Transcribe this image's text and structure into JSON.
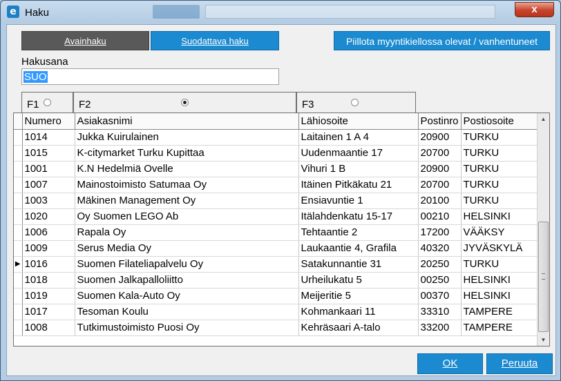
{
  "window": {
    "title": "Haku",
    "app_icon_glyph": "e",
    "close_glyph": "x"
  },
  "toolbar": {
    "key_search_label": "Avainhaku",
    "filter_search_label": "Suodattava haku",
    "hide_label": "Piillota myyntikiellossa olevat / vanhentuneet"
  },
  "search": {
    "label": "Hakusana",
    "value": "SUO"
  },
  "field_options": [
    {
      "label": "F1",
      "selected": false
    },
    {
      "label": "F2",
      "selected": true
    },
    {
      "label": "F3",
      "selected": false
    }
  ],
  "grid": {
    "columns": [
      "Numero",
      "Asiakasnimi",
      "Lähiosoite",
      "Postinro",
      "Postiosoite"
    ],
    "current_row_marker": "▶",
    "rows": [
      {
        "current": false,
        "cells": [
          "1014",
          "Jukka Kuirulainen",
          "Laitainen 1 A 4",
          "20900",
          "TURKU"
        ]
      },
      {
        "current": false,
        "cells": [
          "1015",
          "K-citymarket Turku Kupittaa",
          "Uudenmaantie 17",
          "20700",
          "TURKU"
        ]
      },
      {
        "current": false,
        "cells": [
          "1001",
          "K.N Hedelmiä Ovelle",
          "Vihuri 1 B",
          "20900",
          "TURKU"
        ]
      },
      {
        "current": false,
        "cells": [
          "1007",
          "Mainostoimisto Satumaa Oy",
          "Itäinen Pitkäkatu 21",
          "20700",
          "TURKU"
        ]
      },
      {
        "current": false,
        "cells": [
          "1003",
          "Mäkinen Management Oy",
          "Ensiavuntie 1",
          "20100",
          "TURKU"
        ]
      },
      {
        "current": false,
        "cells": [
          "1020",
          "Oy Suomen LEGO Ab",
          "Itälahdenkatu 15-17",
          "00210",
          "HELSINKI"
        ]
      },
      {
        "current": false,
        "cells": [
          "1006",
          "Rapala Oy",
          "Tehtaantie 2",
          "17200",
          "VÄÄKSY"
        ]
      },
      {
        "current": false,
        "cells": [
          "1009",
          "Serus Media Oy",
          "Laukaantie 4, Grafila",
          "40320",
          "JYVÄSKYLÄ"
        ]
      },
      {
        "current": true,
        "cells": [
          "1016",
          "Suomen Filateliapalvelu Oy",
          "Satakunnantie 31",
          "20250",
          "TURKU"
        ]
      },
      {
        "current": false,
        "cells": [
          "1018",
          "Suomen Jalkapalloliitto",
          "Urheilukatu 5",
          "00250",
          "HELSINKI"
        ]
      },
      {
        "current": false,
        "cells": [
          "1019",
          "Suomen Kala-Auto Oy",
          "Meijeritie 5",
          "00370",
          "HELSINKI"
        ]
      },
      {
        "current": false,
        "cells": [
          "1017",
          "Tesoman Koulu",
          "Kohmankaari 11",
          "33310",
          "TAMPERE"
        ]
      },
      {
        "current": false,
        "cells": [
          "1008",
          "Tutkimustoimisto Puosi Oy",
          "Kehräsaari A-talo",
          "33200",
          "TAMPERE"
        ]
      }
    ]
  },
  "scrollbar": {
    "up_glyph": "▲",
    "down_glyph": "▼"
  },
  "footer": {
    "ok_label": "OK",
    "cancel_label": "Peruuta"
  }
}
